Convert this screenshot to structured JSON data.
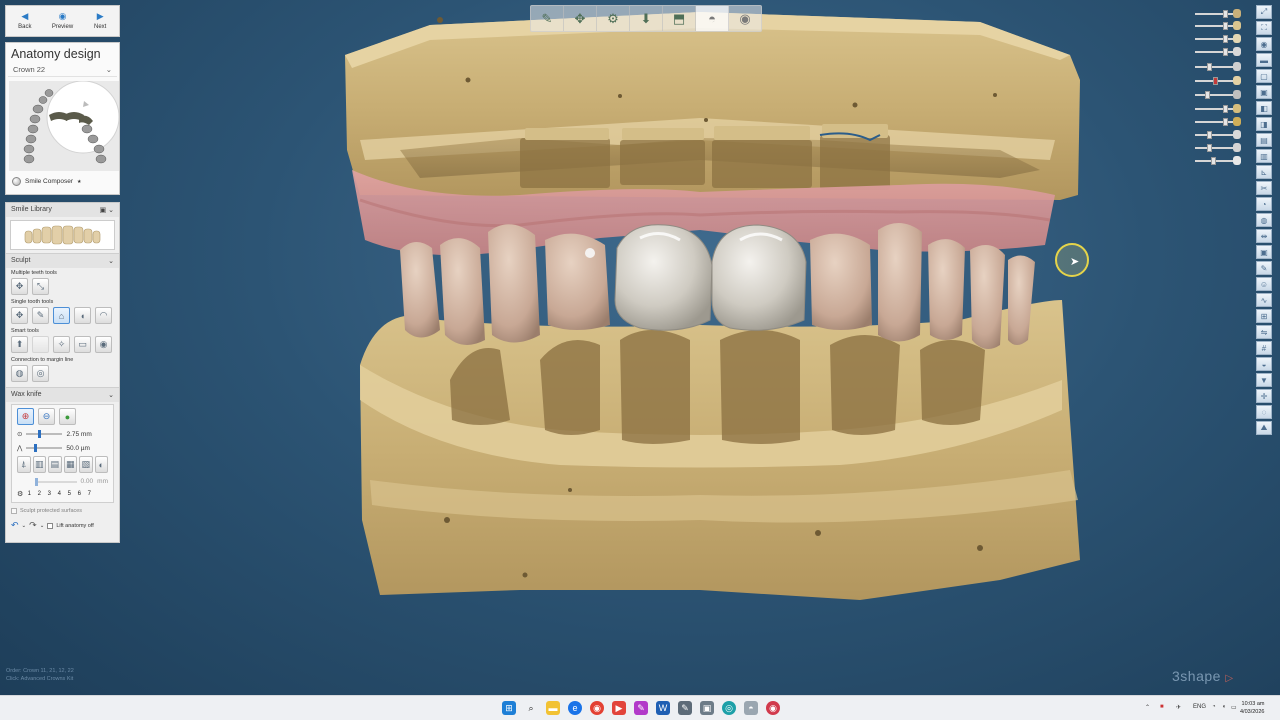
{
  "nav": {
    "back_label": "Back",
    "preview_label": "Preview",
    "next_label": "Next"
  },
  "anatomy": {
    "title": "Anatomy design",
    "crown_label": "Crown 22",
    "smile_composer_label": "Smile Composer"
  },
  "smile_library": {
    "title": "Smile Library"
  },
  "sculpt": {
    "title": "Sculpt",
    "multiple_label": "Multiple teeth tools",
    "single_label": "Single tooth tools",
    "smart_label": "Smart tools",
    "connection_label": "Connection to margin line"
  },
  "wax_knife": {
    "title": "Wax knife",
    "size_value": "2.75 mm",
    "depth_value": "50.0 µm",
    "offset_value": "0.00",
    "offset_unit": "mm",
    "numbers": [
      "1",
      "2",
      "3",
      "4",
      "5",
      "6",
      "7"
    ],
    "protected_label": "Sculpt protected surfaces",
    "lift_label": "Lift anatomy off"
  },
  "viewport": {
    "order_line1": "Order: Crown 11, 21, 12, 22",
    "order_line2": "Click: Advanced Crowns Kit",
    "brand": "3shape"
  },
  "taskbar": {
    "lang": "ENG",
    "time": "10:03 am",
    "date": "4/03/2026"
  },
  "colors": {
    "background": "#2c5474",
    "model_stone": "#cbb37b",
    "gingiva": "#d38f8f",
    "crown": "#d8d4cc",
    "accent": "#2b7bc6"
  }
}
